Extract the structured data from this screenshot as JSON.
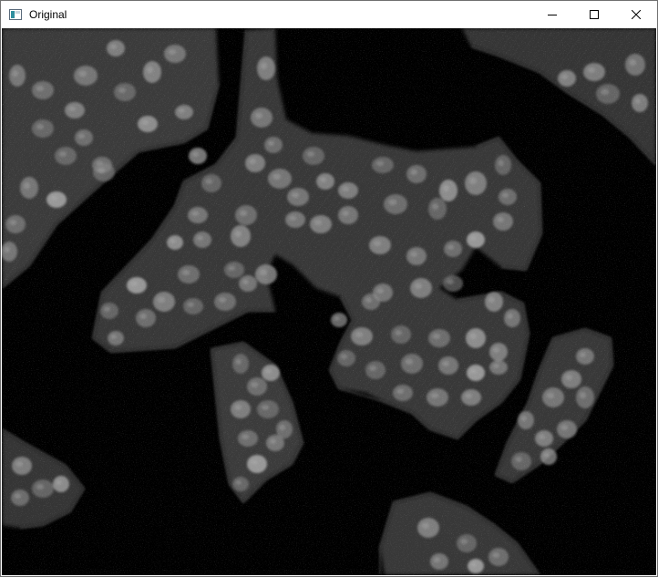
{
  "window": {
    "title": "Original",
    "icons": {
      "app": "opencv-window-icon",
      "minimize": "minimize-icon",
      "maximize": "maximize-icon",
      "close": "close-icon"
    }
  },
  "image": {
    "description_icon": "fluorescence-microscopy-image",
    "colors": {
      "background": "#000000",
      "cytoplasm": "#3a3a3a",
      "cell_edge": "#5a5a5a",
      "nucleus": "#8a8a8a",
      "nucleus_bright": "#a8a8a8"
    }
  }
}
